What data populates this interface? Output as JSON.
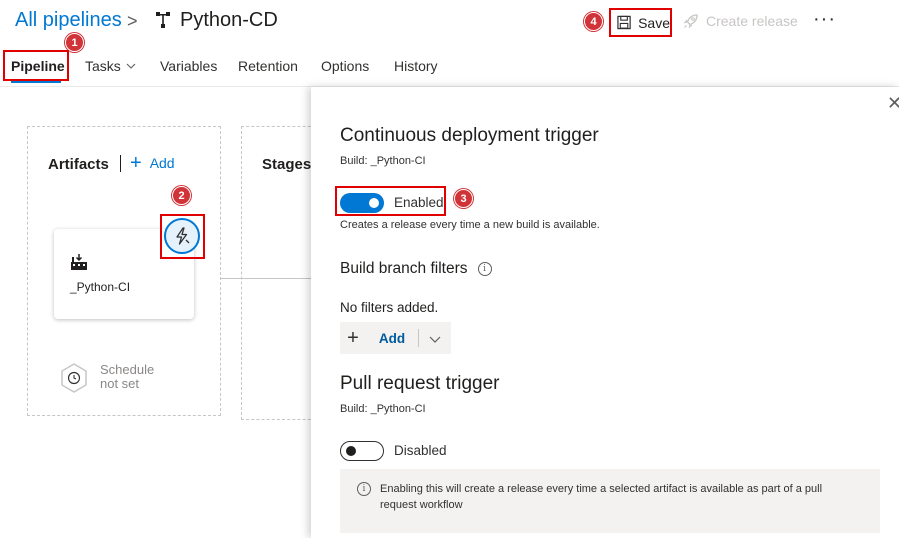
{
  "header": {
    "breadcrumb_root": "All pipelines",
    "breadcrumb_separator": ">",
    "pipeline_name": "Python-CD",
    "save_label": "Save",
    "create_release_label": "Create release",
    "more_label": "···",
    "icons": {
      "pipeline": "pipeline-icon",
      "save": "floppy-disk-icon",
      "create_release": "rocket-icon",
      "more": "ellipsis-icon"
    }
  },
  "tabs": [
    {
      "label": "Pipeline",
      "active": true
    },
    {
      "label": "Tasks",
      "has_dropdown": true
    },
    {
      "label": "Variables"
    },
    {
      "label": "Retention"
    },
    {
      "label": "Options"
    },
    {
      "label": "History"
    }
  ],
  "canvas": {
    "artifacts_title": "Artifacts",
    "add_label": "Add",
    "add_symbol": "+",
    "stages_title": "Stages",
    "artifact_name": "_Python-CI",
    "schedule_line1": "Schedule",
    "schedule_line2": "not set"
  },
  "panel": {
    "close_symbol": "✕",
    "cd_title": "Continuous deployment trigger",
    "cd_build": "Build: _Python-CI",
    "cd_toggle_label": "Enabled",
    "cd_toggle_on": true,
    "cd_description": "Creates a release every time a new build is available.",
    "filters_title": "Build branch filters",
    "filters_info_symbol": "i",
    "no_filters": "No filters added.",
    "add_filter_plus": "+",
    "add_filter_label": "Add",
    "add_filter_chevron": "⌵",
    "pr_title": "Pull request trigger",
    "pr_build": "Build: _Python-CI",
    "pr_toggle_label": "Disabled",
    "pr_toggle_on": false,
    "pr_info_symbol": "i",
    "pr_info": "Enabling this will create a release every time a selected artifact is available as part of a pull request workflow"
  },
  "annotations": [
    "1",
    "2",
    "3",
    "4"
  ],
  "colors": {
    "accent": "#0078d4",
    "annotation_red": "#d13438",
    "highlight_border": "#e00000"
  }
}
